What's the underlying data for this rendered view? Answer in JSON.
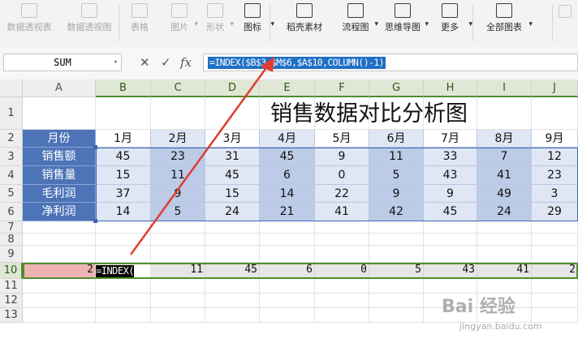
{
  "ribbon": {
    "items": [
      {
        "label": "数据透视表",
        "icon": "pivot-table-icon",
        "dim": true
      },
      {
        "label": "数据透视图",
        "icon": "pivot-chart-icon",
        "dim": true
      },
      {
        "label": "表格",
        "icon": "table-icon",
        "dim": true
      },
      {
        "label": "图片",
        "icon": "picture-icon",
        "dim": true,
        "dropdown": true
      },
      {
        "label": "形状",
        "icon": "shapes-icon",
        "dim": true,
        "dropdown": true
      },
      {
        "label": "图标",
        "icon": "icons-icon",
        "dim": false,
        "dropdown": true
      },
      {
        "label": "稻壳素材",
        "icon": "docer-material-icon",
        "dim": false
      },
      {
        "label": "流程图",
        "icon": "flowchart-icon",
        "dim": false,
        "dropdown": true
      },
      {
        "label": "思维导图",
        "icon": "mindmap-icon",
        "dim": false,
        "dropdown": true
      },
      {
        "label": "更多",
        "icon": "more-icon",
        "dim": false,
        "dropdown": true
      },
      {
        "label": "全部图表",
        "icon": "all-charts-icon",
        "dim": false,
        "dropdown": true
      }
    ]
  },
  "formula_bar": {
    "name_box": "SUM",
    "cancel_symbol": "✕",
    "confirm_symbol": "✓",
    "fx_symbol": "fx",
    "formula": "=INDEX($B$3:$M$6,$A$10,COLUMN()-1)"
  },
  "columns": [
    "A",
    "B",
    "C",
    "D",
    "E",
    "F",
    "G",
    "H",
    "I",
    "J"
  ],
  "rows": [
    "1",
    "2",
    "3",
    "4",
    "5",
    "6",
    "7",
    "8",
    "9",
    "10",
    "11",
    "12",
    "13"
  ],
  "sheet": {
    "title": "销售数据对比分析图",
    "header_label": "月份",
    "months": [
      "1月",
      "2月",
      "3月",
      "4月",
      "5月",
      "6月",
      "7月",
      "8月",
      "9月"
    ],
    "series": [
      {
        "name": "销售额",
        "values": [
          45,
          23,
          31,
          45,
          9,
          11,
          33,
          7,
          12
        ]
      },
      {
        "name": "销售量",
        "values": [
          15,
          11,
          45,
          6,
          0,
          5,
          43,
          41,
          23
        ]
      },
      {
        "name": "毛利润",
        "values": [
          37,
          9,
          15,
          14,
          22,
          9,
          9,
          49,
          3
        ]
      },
      {
        "name": "净利润",
        "values": [
          14,
          5,
          24,
          21,
          41,
          42,
          45,
          24,
          29
        ]
      }
    ],
    "row10": {
      "a_value": "2",
      "editing_text": "=INDEX(",
      "values": [
        "11",
        "45",
        "6",
        "0",
        "5",
        "43",
        "41",
        "2"
      ]
    }
  },
  "watermark": {
    "main": "Bai 经验",
    "sub": "jingyan.baidu.com"
  },
  "colors": {
    "header_blue": "#4d74b7",
    "light_blue": "#dfe6f4",
    "dark_blue": "#bccbe6",
    "selection_green": "#4e8f2f",
    "arrow_red": "#e23b30",
    "row10_a_fill": "#f0b3b3"
  }
}
